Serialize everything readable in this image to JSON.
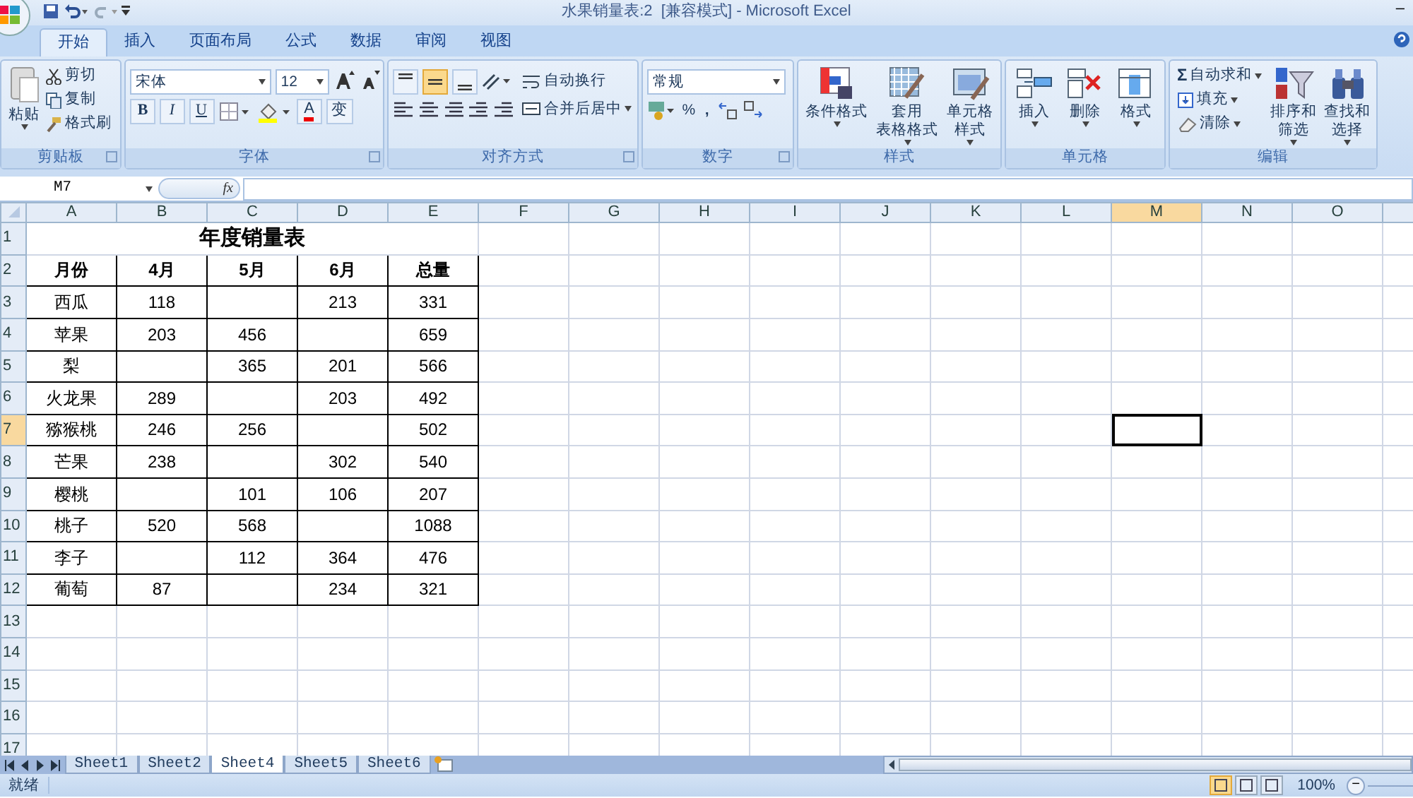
{
  "window": {
    "title": "水果销量表:2  [兼容模式] - Microsoft Excel",
    "minimize": "–"
  },
  "tabs": [
    {
      "label": "开始",
      "selected": true
    },
    {
      "label": "插入",
      "selected": false
    },
    {
      "label": "页面布局",
      "selected": false
    },
    {
      "label": "公式",
      "selected": false
    },
    {
      "label": "数据",
      "selected": false
    },
    {
      "label": "审阅",
      "selected": false
    },
    {
      "label": "视图",
      "selected": false
    }
  ],
  "ribbon": [
    {
      "kind": "clipboard",
      "label": "剪贴板",
      "paste": "粘贴",
      "items": [
        "剪切",
        "复制",
        "格式刷"
      ]
    },
    {
      "kind": "font",
      "label": "字体",
      "font_name": "宋体",
      "font_size": "12",
      "bold": "B",
      "italic": "I",
      "underline": "U",
      "font_color": "A",
      "phonetic": "变"
    },
    {
      "kind": "alignment",
      "label": "对齐方式",
      "vertical": [
        {
          "selected": false
        },
        {
          "selected": true
        },
        {
          "selected": false
        }
      ],
      "wrap": "自动换行",
      "merge": "合并后居中"
    },
    {
      "kind": "number",
      "label": "数字",
      "format": "常规",
      "percent": "%",
      "comma": ","
    },
    {
      "kind": "large",
      "label": "样式",
      "buttons": [
        {
          "lines": [
            "条件格式"
          ]
        },
        {
          "lines": [
            "套用",
            "表格格式"
          ]
        },
        {
          "lines": [
            "单元格",
            "样式"
          ]
        }
      ]
    },
    {
      "kind": "large",
      "label": "单元格",
      "buttons": [
        {
          "lines": [
            "插入"
          ]
        },
        {
          "lines": [
            "删除"
          ]
        },
        {
          "lines": [
            "格式"
          ]
        }
      ]
    },
    {
      "kind": "editing",
      "label": "编辑",
      "sum_sign": "Σ",
      "small": [
        "自动求和",
        "填充",
        "清除"
      ],
      "large": [
        {
          "lines": [
            "排序和",
            "筛选"
          ]
        },
        {
          "lines": [
            "查找和",
            "选择"
          ]
        }
      ]
    }
  ],
  "name_box": "M7",
  "fx": "fx",
  "columns": [
    {
      "label": "A",
      "selected": false
    },
    {
      "label": "B",
      "selected": false
    },
    {
      "label": "C",
      "selected": false
    },
    {
      "label": "D",
      "selected": false
    },
    {
      "label": "E",
      "selected": false
    },
    {
      "label": "F",
      "selected": false
    },
    {
      "label": "G",
      "selected": false
    },
    {
      "label": "H",
      "selected": false
    },
    {
      "label": "I",
      "selected": false
    },
    {
      "label": "J",
      "selected": false
    },
    {
      "label": "K",
      "selected": false
    },
    {
      "label": "L",
      "selected": false
    },
    {
      "label": "M",
      "selected": true
    },
    {
      "label": "N",
      "selected": false
    },
    {
      "label": "O",
      "selected": false
    }
  ],
  "rows": [
    {
      "label": "1",
      "selected": false,
      "kind": "title",
      "title": "年度销量表"
    },
    {
      "label": "2",
      "selected": false,
      "kind": "header",
      "cells": [
        "月份",
        "4月",
        "5月",
        "6月",
        "总量"
      ]
    },
    {
      "label": "3",
      "selected": false,
      "kind": "data",
      "cells": [
        "西瓜",
        "118",
        null,
        "213",
        "331"
      ]
    },
    {
      "label": "4",
      "selected": false,
      "kind": "data",
      "cells": [
        "苹果",
        "203",
        "456",
        null,
        "659"
      ]
    },
    {
      "label": "5",
      "selected": false,
      "kind": "data",
      "cells": [
        "梨",
        null,
        "365",
        "201",
        "566"
      ]
    },
    {
      "label": "6",
      "selected": false,
      "kind": "data",
      "cells": [
        "火龙果",
        "289",
        null,
        "203",
        "492"
      ]
    },
    {
      "label": "7",
      "selected": true,
      "kind": "data",
      "cells": [
        "猕猴桃",
        "246",
        "256",
        null,
        "502"
      ]
    },
    {
      "label": "8",
      "selected": false,
      "kind": "data",
      "cells": [
        "芒果",
        "238",
        null,
        "302",
        "540"
      ]
    },
    {
      "label": "9",
      "selected": false,
      "kind": "data",
      "cells": [
        "樱桃",
        null,
        "101",
        "106",
        "207"
      ]
    },
    {
      "label": "10",
      "selected": false,
      "kind": "data",
      "cells": [
        "桃子",
        "520",
        "568",
        null,
        "1088"
      ]
    },
    {
      "label": "11",
      "selected": false,
      "kind": "data",
      "cells": [
        "李子",
        null,
        "112",
        "364",
        "476"
      ]
    },
    {
      "label": "12",
      "selected": false,
      "kind": "data",
      "cells": [
        "葡萄",
        "87",
        null,
        "234",
        "321"
      ]
    },
    {
      "label": "13",
      "selected": false,
      "kind": "empty"
    },
    {
      "label": "14",
      "selected": false,
      "kind": "empty"
    },
    {
      "label": "15",
      "selected": false,
      "kind": "empty"
    },
    {
      "label": "16",
      "selected": false,
      "kind": "empty"
    },
    {
      "label": "17",
      "selected": false,
      "kind": "empty"
    }
  ],
  "sheet_tabs": [
    {
      "label": "Sheet1",
      "selected": false
    },
    {
      "label": "Sheet2",
      "selected": false
    },
    {
      "label": "Sheet4",
      "selected": true
    },
    {
      "label": "Sheet5",
      "selected": false
    },
    {
      "label": "Sheet6",
      "selected": false
    }
  ],
  "status_bar": {
    "text": "就绪",
    "views": [
      {
        "selected": true
      },
      {
        "selected": false
      },
      {
        "selected": false
      }
    ],
    "zoom": "100%",
    "zoom_out": "−"
  }
}
